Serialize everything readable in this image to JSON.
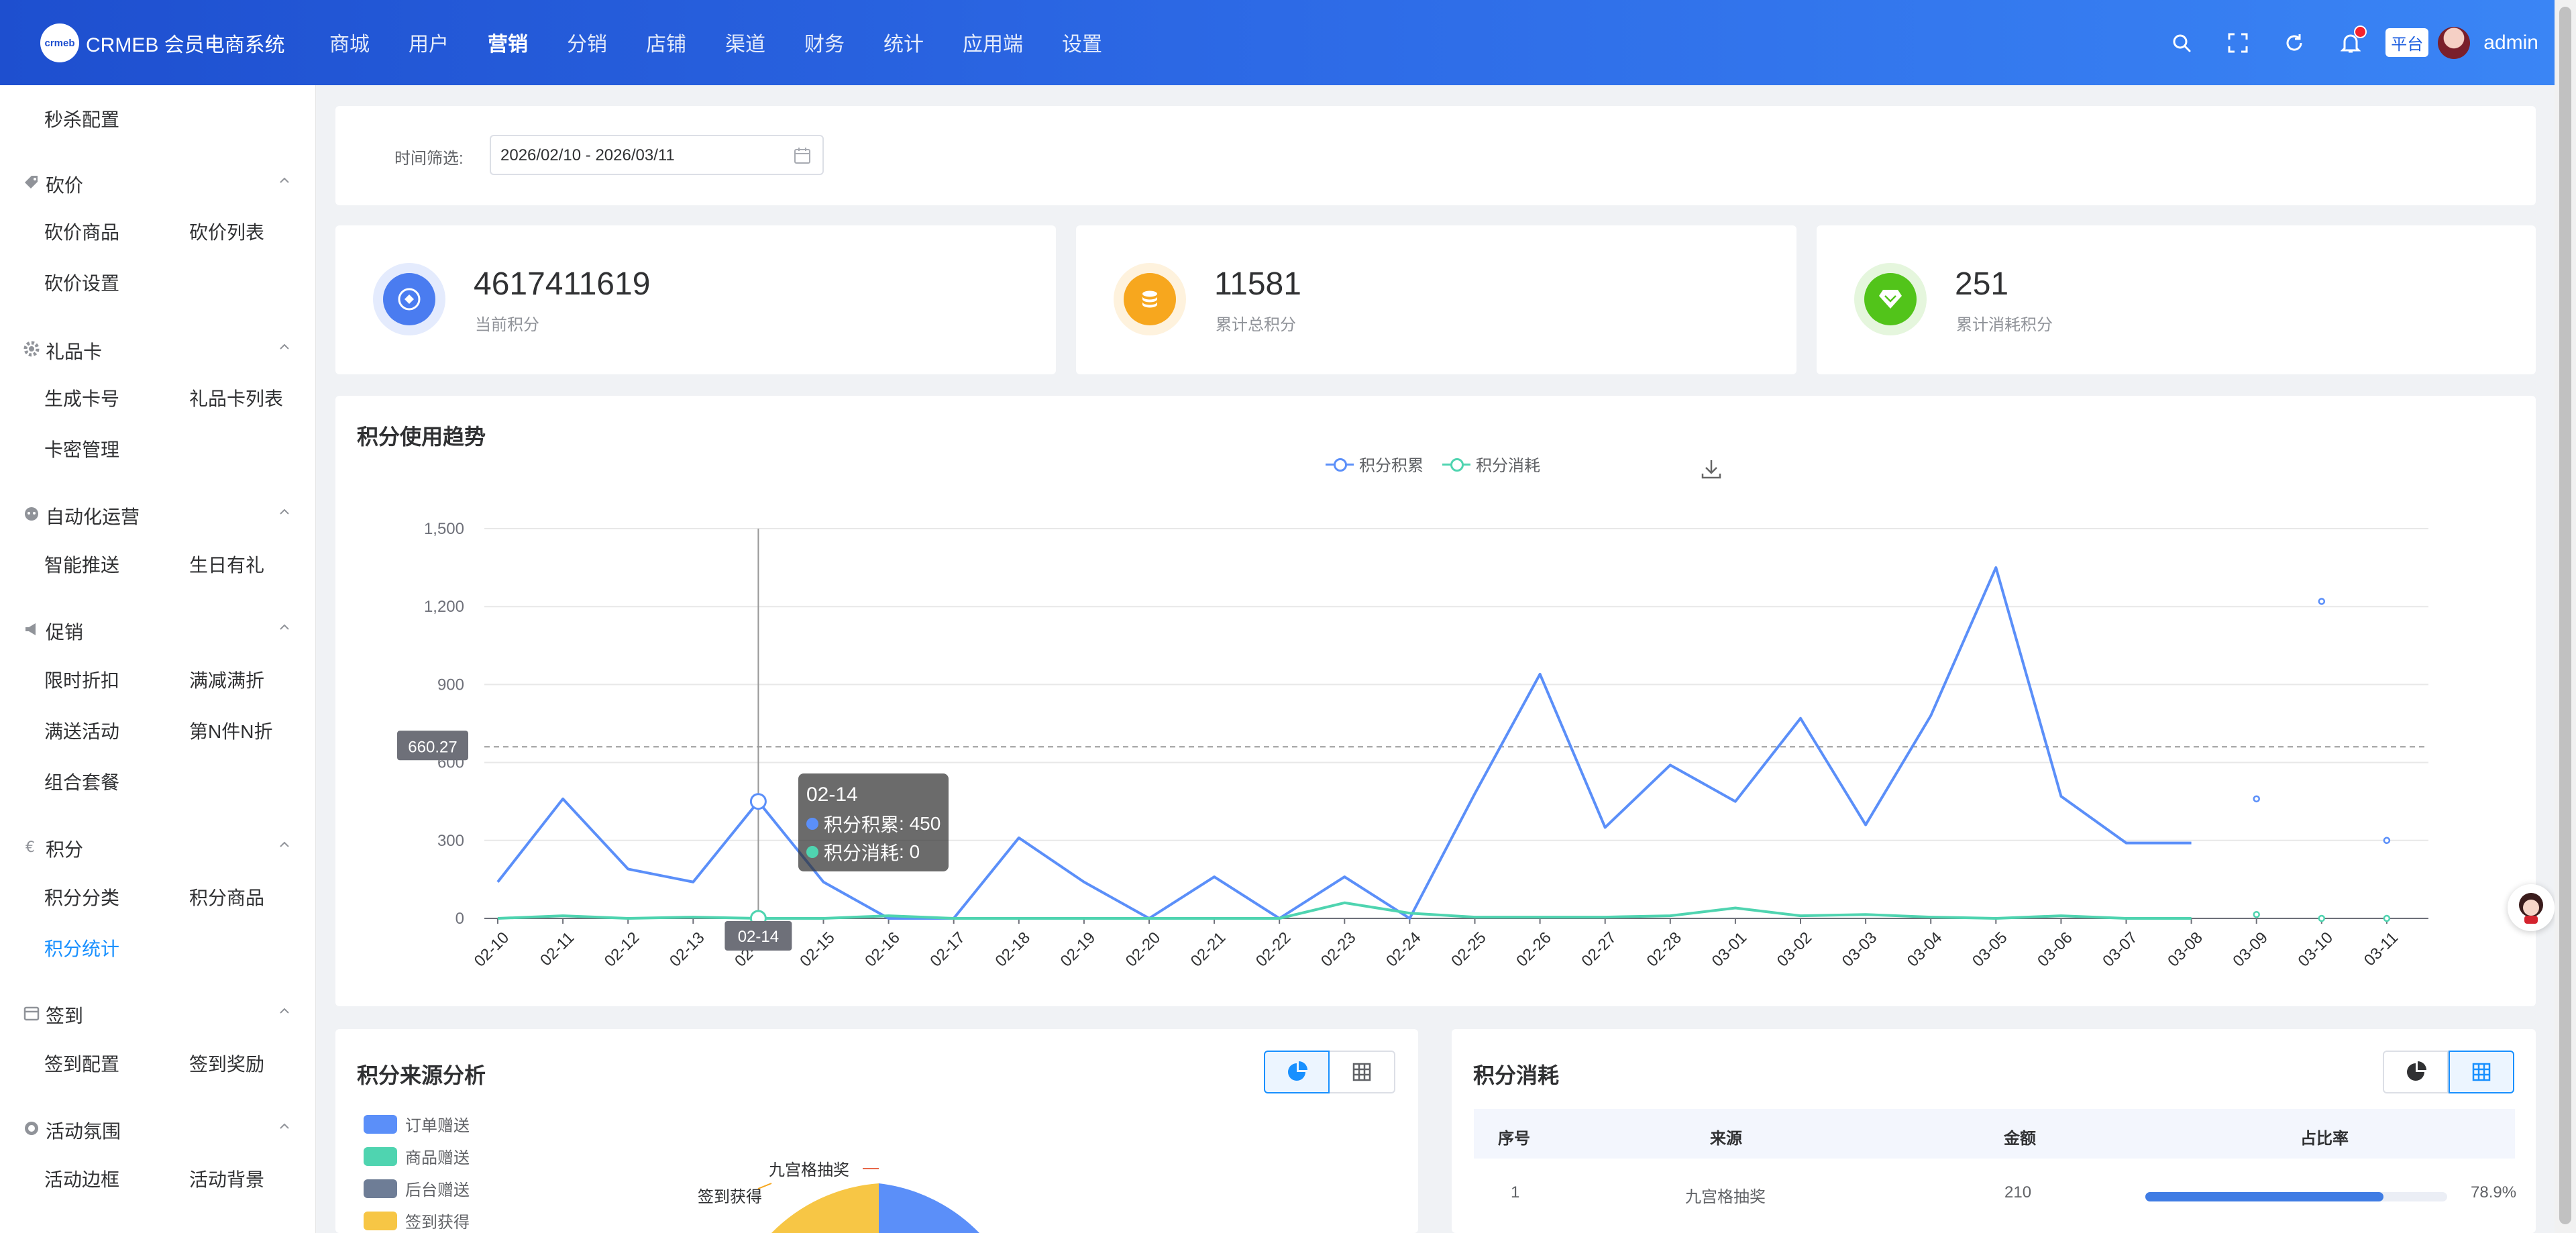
{
  "app": {
    "logo_badge": "crmeb",
    "title": "CRMEB 会员电商系统"
  },
  "topnav": [
    {
      "label": "商城"
    },
    {
      "label": "用户"
    },
    {
      "label": "营销",
      "active": true
    },
    {
      "label": "分销"
    },
    {
      "label": "店铺"
    },
    {
      "label": "渠道"
    },
    {
      "label": "财务"
    },
    {
      "label": "统计"
    },
    {
      "label": "应用端"
    },
    {
      "label": "设置"
    }
  ],
  "topbar_right": {
    "platform": "平台",
    "user": "admin",
    "icons": [
      "search-icon",
      "fullscreen-icon",
      "refresh-icon",
      "bell-icon"
    ]
  },
  "sidebar": {
    "top_item": "秒杀配置",
    "groups": [
      {
        "label": "砍价",
        "icon": "tag-icon",
        "items": [
          "砍价商品",
          "砍价列表",
          "砍价设置"
        ]
      },
      {
        "label": "礼品卡",
        "icon": "gear-icon",
        "items": [
          "生成卡号",
          "礼品卡列表",
          "卡密管理"
        ]
      },
      {
        "label": "自动化运营",
        "icon": "robot-icon",
        "items": [
          "智能推送",
          "生日有礼"
        ]
      },
      {
        "label": "促销",
        "icon": "megaphone-icon",
        "items": [
          "限时折扣",
          "满减满折",
          "满送活动",
          "第N件N折",
          "组合套餐"
        ]
      },
      {
        "label": "积分",
        "icon": "euro-icon",
        "items": [
          "积分分类",
          "积分商品",
          "积分统计"
        ],
        "active_item": "积分统计"
      },
      {
        "label": "签到",
        "icon": "calendar-icon",
        "items": [
          "签到配置",
          "签到奖励"
        ]
      },
      {
        "label": "活动氛围",
        "icon": "atmosphere-icon",
        "items": [
          "活动边框",
          "活动背景"
        ]
      }
    ]
  },
  "filter": {
    "label": "时间筛选:",
    "date_range": "2026/02/10 - 2026/03/11"
  },
  "stats": [
    {
      "value": "4617411619",
      "label": "当前积分",
      "color": "#4a7cf0",
      "icon": "points-icon"
    },
    {
      "value": "11581",
      "label": "累计总积分",
      "color": "#f7a71e",
      "icon": "coins-icon"
    },
    {
      "value": "251",
      "label": "累计消耗积分",
      "color": "#52c41a",
      "icon": "diamond-icon"
    }
  ],
  "trend": {
    "title": "积分使用趋势",
    "tooltip": {
      "date": "02-14",
      "rows": [
        {
          "name": "积分积累",
          "value": "450"
        },
        {
          "name": "积分消耗",
          "value": "0"
        }
      ]
    },
    "axis_pointer_label": "02-14",
    "mark_line_label": "660.27"
  },
  "chart_data": {
    "type": "line",
    "categories": [
      "02-10",
      "02-11",
      "02-12",
      "02-13",
      "02-14",
      "02-15",
      "02-16",
      "02-17",
      "02-18",
      "02-19",
      "02-20",
      "02-21",
      "02-22",
      "02-23",
      "02-24",
      "02-25",
      "02-26",
      "02-27",
      "02-28",
      "03-01",
      "03-02",
      "03-03",
      "03-04",
      "03-05",
      "03-06",
      "03-07",
      "03-08",
      "03-09",
      "03-10",
      "03-11"
    ],
    "series": [
      {
        "name": "积分积累",
        "color": "#5b8ff9",
        "values": [
          140,
          460,
          190,
          140,
          450,
          140,
          0,
          0,
          310,
          140,
          0,
          160,
          0,
          160,
          0,
          480,
          940,
          350,
          590,
          450,
          770,
          360,
          780,
          1350,
          470,
          290,
          290,
          460,
          1220,
          300
        ]
      },
      {
        "name": "积分消耗",
        "color": "#4fd4b0",
        "values": [
          0,
          10,
          0,
          5,
          0,
          0,
          10,
          0,
          0,
          0,
          0,
          0,
          0,
          60,
          20,
          5,
          5,
          5,
          10,
          40,
          10,
          15,
          5,
          0,
          10,
          0,
          0,
          15,
          0,
          0
        ]
      }
    ],
    "ylim": [
      0,
      1500
    ],
    "yticks": [
      "0",
      "300",
      "600",
      "900",
      "1,200",
      "1,500"
    ],
    "mark_line": {
      "value": 660.27,
      "label": "660.27"
    },
    "legend": "top-center",
    "grid": true
  },
  "source": {
    "title": "积分来源分析",
    "legend": [
      {
        "name": "订单赠送",
        "color": "#5b8ff9"
      },
      {
        "name": "商品赠送",
        "color": "#4fd4b0"
      },
      {
        "name": "后台赠送",
        "color": "#6e7d96"
      },
      {
        "name": "签到获得",
        "color": "#f7c645"
      }
    ],
    "pie_labels": [
      {
        "text": "九宫格抽奖",
        "color": "#e8684a"
      },
      {
        "text": "签到获得",
        "color": "#f7a71e"
      }
    ]
  },
  "consume": {
    "title": "积分消耗",
    "columns": [
      "序号",
      "来源",
      "金额",
      "占比率"
    ],
    "rows": [
      {
        "no": "1",
        "source": "九宫格抽奖",
        "amount": "210",
        "percent": "78.9%",
        "ratio": 0.789
      }
    ]
  }
}
